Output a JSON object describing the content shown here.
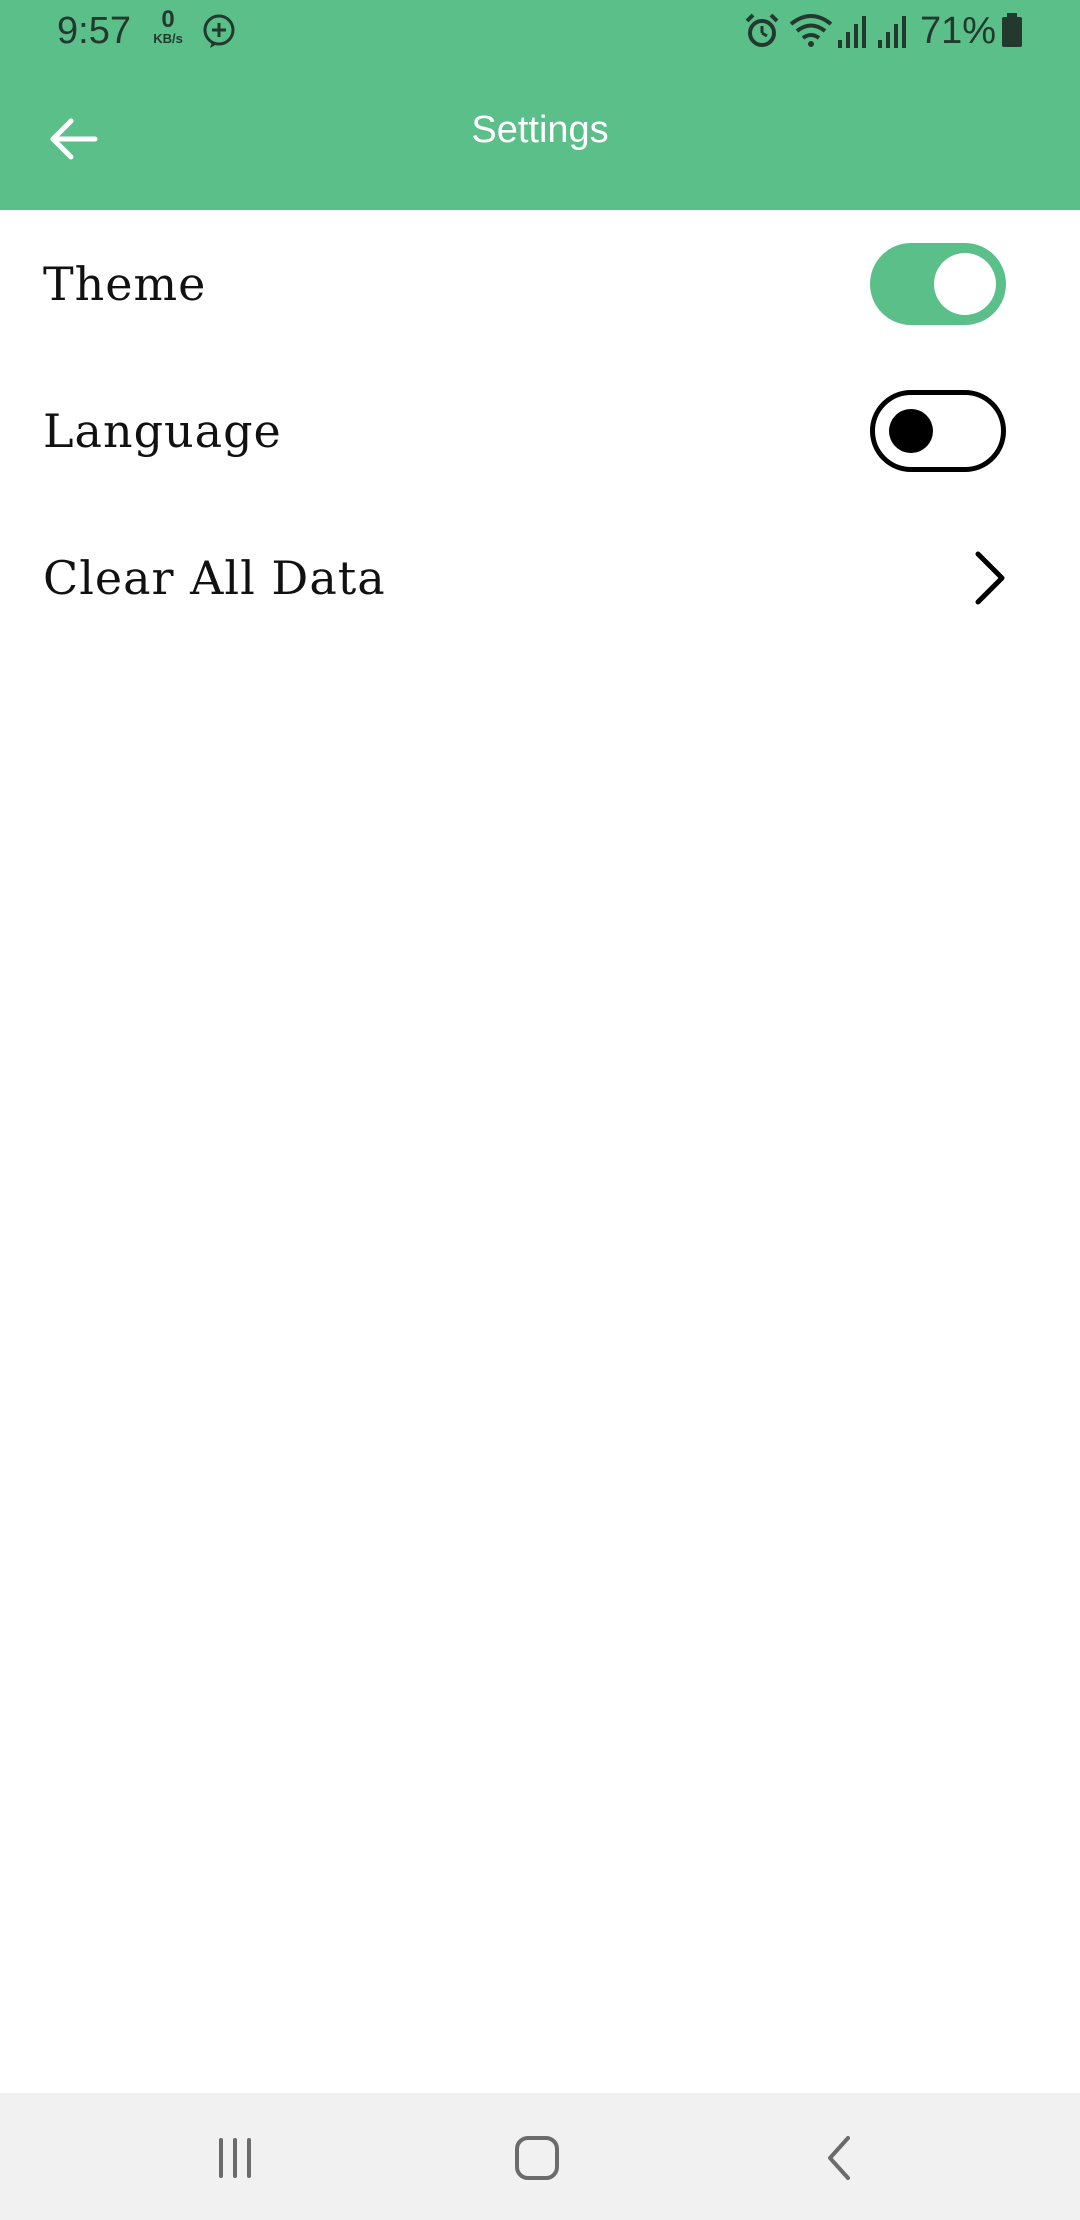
{
  "status_bar": {
    "time": "9:57",
    "net_speed_value": "0",
    "net_speed_unit": "KB/s",
    "battery_percent": "71%",
    "icons": [
      "messenger-icon",
      "alarm-icon",
      "wifi-icon",
      "signal-icon",
      "signal-icon",
      "battery-icon"
    ]
  },
  "app_bar": {
    "title": "Settings",
    "back_icon": "arrow-left-icon"
  },
  "settings": {
    "items": [
      {
        "label": "Theme",
        "control": "toggle",
        "checked": true
      },
      {
        "label": "Language",
        "control": "toggle",
        "checked": false
      },
      {
        "label": "Clear All Data",
        "control": "chevron",
        "icon": "chevron-right-icon"
      }
    ]
  },
  "nav_bar": {
    "buttons": [
      "recent-apps-icon",
      "home-icon",
      "back-icon"
    ]
  },
  "colors": {
    "accent": "#5bbf8a",
    "nav_bar_bg": "#f1f1f1",
    "text": "#111111"
  }
}
